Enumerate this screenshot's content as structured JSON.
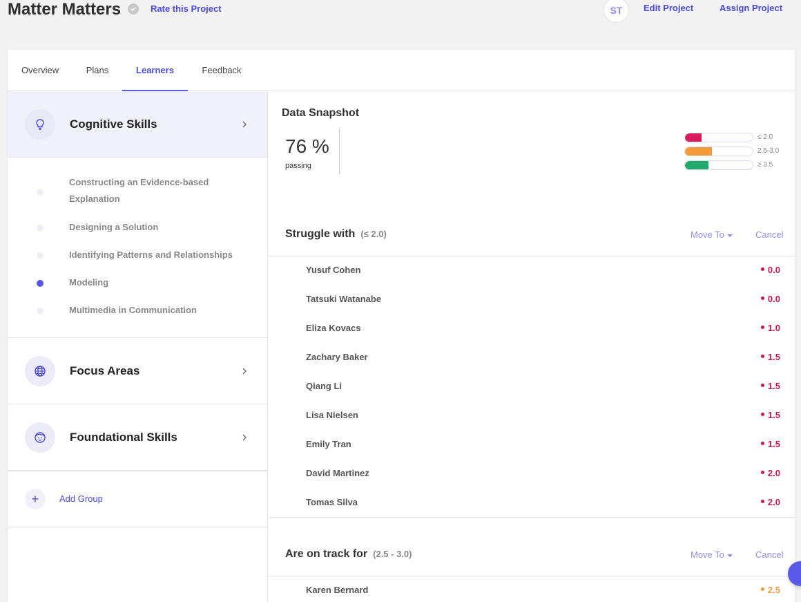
{
  "header": {
    "title": "Matter Matters",
    "rate_label": "Rate this Project",
    "avatar_initials": "ST",
    "edit_label": "Edit Project",
    "assign_label": "Assign Project"
  },
  "tabs": [
    {
      "label": "Overview",
      "active": false
    },
    {
      "label": "Plans",
      "active": false
    },
    {
      "label": "Learners",
      "active": true
    },
    {
      "label": "Feedback",
      "active": false
    }
  ],
  "sidebar": {
    "groups": [
      {
        "label": "Cognitive Skills",
        "icon": "lightbulb-icon",
        "selected": true
      },
      {
        "label": "Focus Areas",
        "icon": "globe-icon",
        "selected": false
      },
      {
        "label": "Foundational Skills",
        "icon": "face-icon",
        "selected": false
      }
    ],
    "sub_items": [
      {
        "label": "Constructing an Evidence-based Explanation",
        "active": false
      },
      {
        "label": "Designing a Solution",
        "active": false
      },
      {
        "label": "Identifying Patterns and Relationships",
        "active": false
      },
      {
        "label": "Modeling",
        "active": true
      },
      {
        "label": "Multimedia in Communication",
        "active": false
      }
    ],
    "add_group_label": "Add Group"
  },
  "snapshot": {
    "title": "Data Snapshot",
    "passing_value": "76 %",
    "passing_label": "passing",
    "legend": [
      {
        "label": "≤ 2.0",
        "fraction": 0.24,
        "color": "#d81b5a"
      },
      {
        "label": "2.5-3.0",
        "fraction": 0.4,
        "color": "#f59a3a"
      },
      {
        "label": "≥ 3.5",
        "fraction": 0.35,
        "color": "#22a86b"
      }
    ]
  },
  "sections": [
    {
      "title": "Struggle with",
      "range": "(≤ 2.0)",
      "move_to_label": "Move To",
      "cancel_label": "Cancel",
      "score_color": "#c8174f",
      "learners": [
        {
          "name": "Yusuf Cohen",
          "score": "0.0"
        },
        {
          "name": "Tatsuki Watanabe",
          "score": "0.0"
        },
        {
          "name": "Eliza Kovacs",
          "score": "1.0"
        },
        {
          "name": "Zachary Baker",
          "score": "1.5"
        },
        {
          "name": "Qiang Li",
          "score": "1.5"
        },
        {
          "name": "Lisa Nielsen",
          "score": "1.5"
        },
        {
          "name": "Emily Tran",
          "score": "1.5"
        },
        {
          "name": "David Martinez",
          "score": "2.0"
        },
        {
          "name": "Tomas Silva",
          "score": "2.0"
        }
      ]
    },
    {
      "title": "Are on track for",
      "range": "(2.5 - 3.0)",
      "move_to_label": "Move To",
      "cancel_label": "Cancel",
      "score_color": "#f59a3a",
      "learners": [
        {
          "name": "Karen Bernard",
          "score": "2.5"
        }
      ]
    }
  ]
}
